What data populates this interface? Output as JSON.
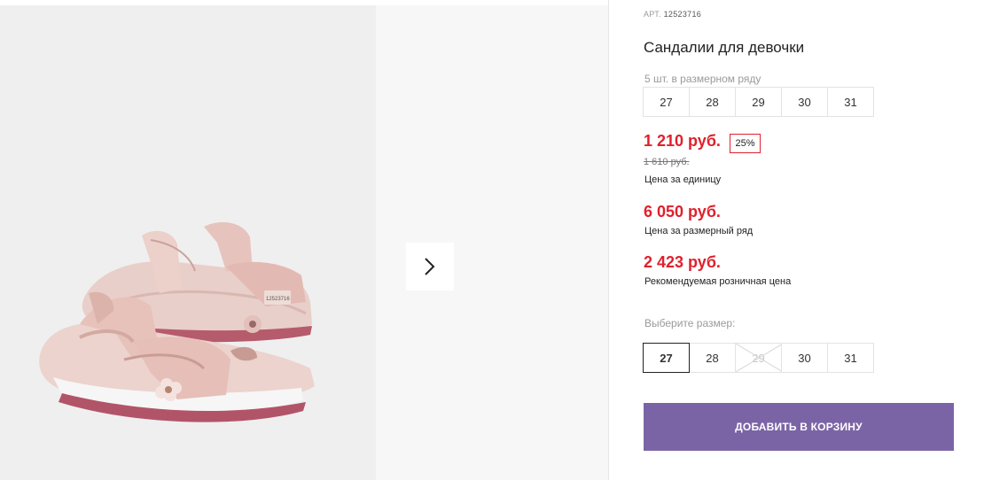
{
  "product": {
    "art_label": "АРТ.",
    "art_number": "12523716",
    "title": "Сандалии для девочки",
    "image_alt_label": "12523716"
  },
  "size_range": {
    "note": "5 шт. в размерном ряду",
    "sizes": [
      "27",
      "28",
      "29",
      "30",
      "31"
    ]
  },
  "prices": {
    "unit_price": "1 210 руб.",
    "discount": "25%",
    "old_price": "1 610 руб.",
    "unit_label": "Цена за единицу",
    "range_price": "6 050 руб.",
    "range_label": "Цена за размерный ряд",
    "retail_price": "2 423 руб.",
    "retail_label": "Рекомендуемая розничная цена"
  },
  "size_select": {
    "label": "Выберите размер:",
    "options": [
      "27",
      "28",
      "29",
      "30",
      "31"
    ],
    "selected": "27",
    "disabled": [
      "29"
    ]
  },
  "actions": {
    "add_to_cart": "ДОБАВИТЬ В КОРЗИНУ"
  },
  "colors": {
    "price_red": "#e0202c",
    "button_purple": "#7b64a6"
  },
  "icons": {
    "next": "chevron-right-icon"
  }
}
